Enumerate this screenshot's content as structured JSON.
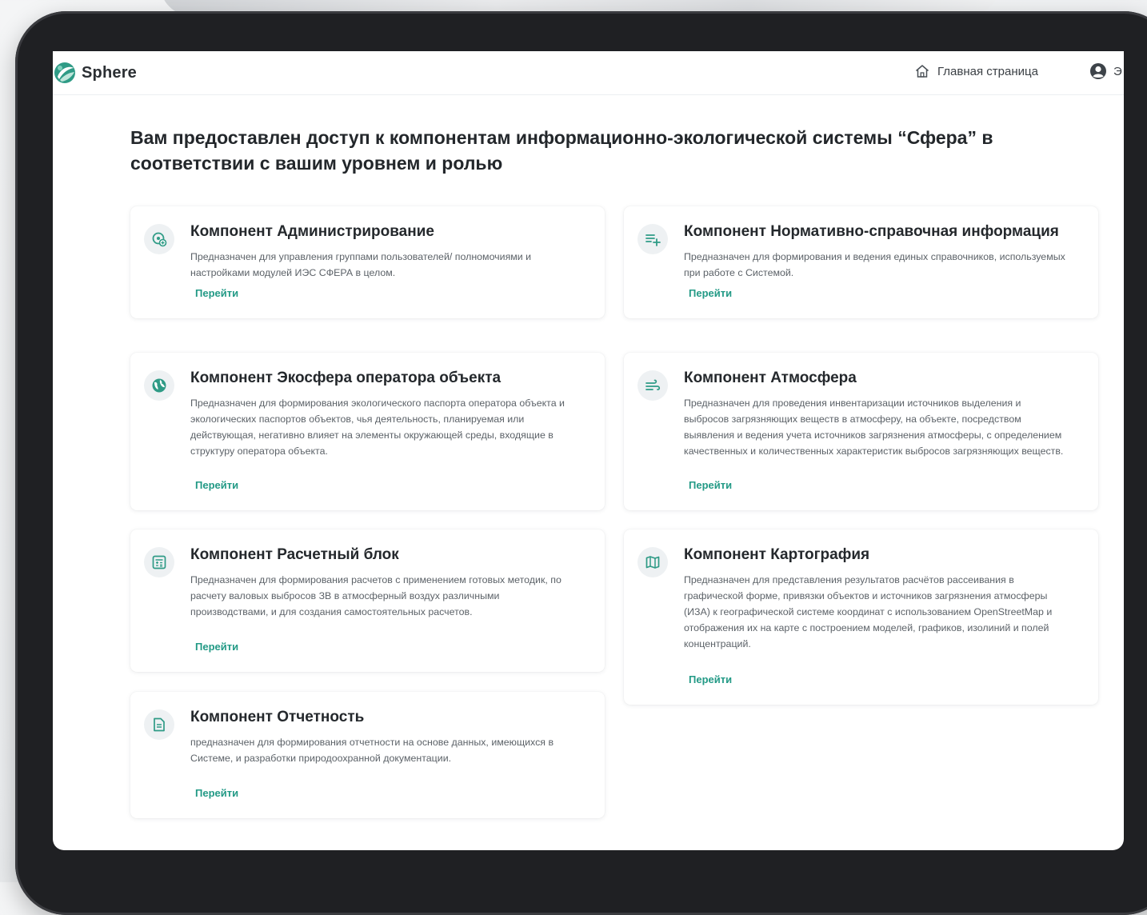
{
  "app": {
    "name": "Sphere",
    "home_label": "Главная страница",
    "user_label": "Э",
    "accent_color": "#239a86",
    "icons": {
      "logo": "sphere-logo",
      "home": "home-icon",
      "user": "user-circle-icon"
    }
  },
  "main": {
    "heading": "Вам предоставлен доступ к компонентам информационно-экологической системы “Сфера” в соответствии с вашим уровнем и ролью"
  },
  "cards": [
    {
      "title": "Компонент Администрирование",
      "description": "Предназначен для управления группами пользователей/ полномочиями и настройками модулей ИЭС СФЕРА в целом.",
      "link": "Перейти",
      "icon": "admin-settings-icon"
    },
    {
      "title": "Компонент Нормативно-справочная информация",
      "description": "Предназначен для формирования и ведения единых справочников, используемых при работе с Системой.",
      "link": "Перейти",
      "icon": "list-add-icon"
    },
    {
      "title": "Компонент  Экосфера оператора объекта",
      "description": "Предназначен для формирования экологического паспорта оператора объекта и экологических паспортов объектов, чья деятельность, планируемая или действующая, негативно влияет на элементы окружающей среды, входящие в структуру оператора объекта.",
      "link": "Перейти",
      "icon": "globe-icon"
    },
    {
      "title": "Компонент Атмосфера",
      "description": "Предназначен для проведения инвентаризации источников выделения и выбросов загрязняющих веществ в атмосферу, на объекте, посредством выявления и ведения учета источников загрязнения атмосферы, с определением качественных и количественных характеристик выбросов загрязняющих веществ.",
      "link": "Перейти",
      "icon": "wind-icon"
    },
    {
      "title": "Компонент Расчетный блок",
      "description": "Предназначен для формирования расчетов с применением готовых методик, по расчету валовых выбросов ЗВ в атмосферный воздух различными производствами, и для создания самостоятельных расчетов.",
      "link": "Перейти",
      "icon": "calculator-icon"
    },
    {
      "title": "Компонент Картография",
      "description": "Предназначен для представления результатов расчётов рассеивания в графической форме, привязки объектов и источников загрязнения атмосферы (ИЗА) к географической системе координат с использованием OpenStreetMap и отображения их на карте с построением моделей, графиков, изолиний и полей концентраций.",
      "link": "Перейти",
      "icon": "map-icon"
    },
    {
      "title": "Компонент Отчетность",
      "description": "предназначен для формирования отчетности на основе данных, имеющихся в Системе, и разработки природоохранной документации.",
      "link": "Перейти",
      "icon": "document-icon"
    }
  ]
}
